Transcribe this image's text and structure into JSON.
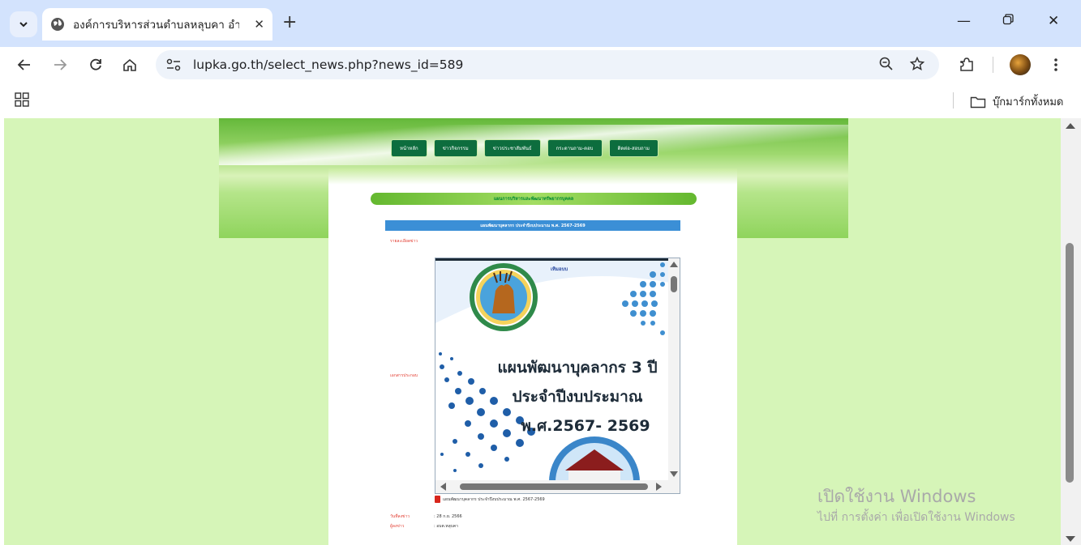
{
  "browser": {
    "tab_title": "องค์การบริหารส่วนตำบลหลุบคา อำเภ",
    "url": "lupka.go.th/select_news.php?news_id=589",
    "bookmarks_label": "บุ๊กมาร์กทั้งหมด"
  },
  "site": {
    "menu": [
      "หน้าหลัก",
      "ข่าวกิจกรรม",
      "ข่าวประชาสัมพันธ์",
      "กระดานถาม-ตอบ",
      "ติดต่อ-สอบถาม"
    ],
    "section_title": "แผนการบริหารและพัฒนาทรัพยากรบุคคล",
    "news_title": "แผนพัฒนาบุคลากร ประจำปีงบประมาณ พ.ศ. 2567-2569",
    "label_detail": "รายละเอียดข่าว",
    "label_attachment": "เอกสารประกอบ",
    "pdf": {
      "welcome": "เทิมอบบ",
      "seal_top": "อบต.หลุบคา",
      "seal_bottom": "อ.แก้งคร้อ จ.ชัยภูมิ",
      "line1": "แผนพัฒนาบุคลากร 3 ปี",
      "line2": "ประจำปีงบประมาณ",
      "line3": "พ.ศ.2567- 2569"
    },
    "file_name": "แผนพัฒนาบุคลากร ประจำปีงบประมาณ พ.ศ. 2567-2569",
    "label_date": "วันที่ลงข่าว",
    "date_value": ": 28 ก.ย. 2566",
    "label_author": "ผู้ลงข่าว",
    "author_value": ": อบต.หลุบคา"
  },
  "watermark": {
    "line1": "เปิดใช้งาน Windows",
    "line2": "ไปที่ การตั้งค่า เพื่อเปิดใช้งาน Windows"
  }
}
